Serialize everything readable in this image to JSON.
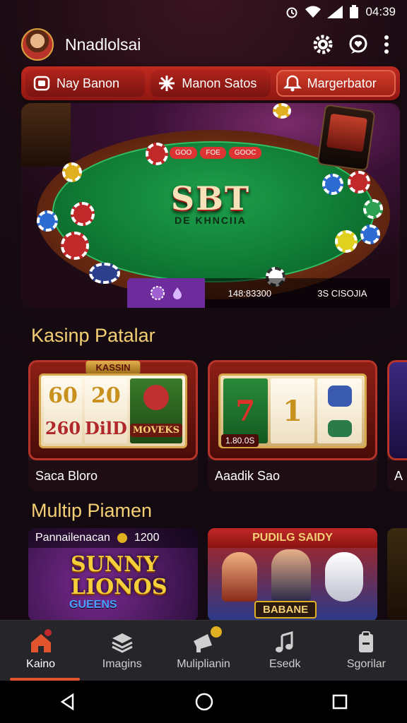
{
  "status_bar": {
    "time": "04:39"
  },
  "header": {
    "title": "Nnadlolsai"
  },
  "categories": [
    {
      "label": "Nay Banon",
      "icon": "slot-icon"
    },
    {
      "label": "Manon Satos",
      "icon": "star-icon"
    },
    {
      "label": "Margerbator",
      "icon": "bell-icon"
    }
  ],
  "hero": {
    "title": "SBT",
    "subtitle": "DE KHNCIIA",
    "stat_left": "148:83300",
    "stat_right_label": "3S CISOJIA",
    "table_labels": [
      "GOO",
      "FOE",
      "GOOC"
    ]
  },
  "casino_section": {
    "title": "Kasinp Patalar",
    "tiles": [
      {
        "label": "Saca Bloro",
        "tag": "KASSIN",
        "reels": [
          "60",
          "20",
          "MOVEKS",
          "260",
          "DilD",
          ""
        ]
      },
      {
        "label": "Aaadik Sao",
        "tag": "",
        "reels": [
          "7",
          "1",
          "",
          "",
          "",
          ""
        ],
        "badge": "1.80.0S"
      },
      {
        "label": "A"
      }
    ]
  },
  "multi_section": {
    "title": "Multip Piamen",
    "tiles": [
      {
        "head": "Pannailenacan",
        "coin": "1200",
        "title": "SUNNY LIONOS",
        "sub": "GUEENS"
      },
      {
        "head": "PUDILG SAIDY",
        "footer": "BABANE"
      },
      {
        "head": ""
      }
    ]
  },
  "bottom_nav": [
    {
      "label": "Kaino",
      "icon": "home-icon",
      "active": true
    },
    {
      "label": "Imagins",
      "icon": "cards-icon"
    },
    {
      "label": "Muliplianin",
      "icon": "megaphone-icon"
    },
    {
      "label": "Esedk",
      "icon": "music-icon"
    },
    {
      "label": "Sgorilar",
      "icon": "clipboard-icon"
    }
  ],
  "colors": {
    "accent": "#e0542e",
    "gold": "#f5cf73",
    "pill_red": "#b0231b"
  }
}
